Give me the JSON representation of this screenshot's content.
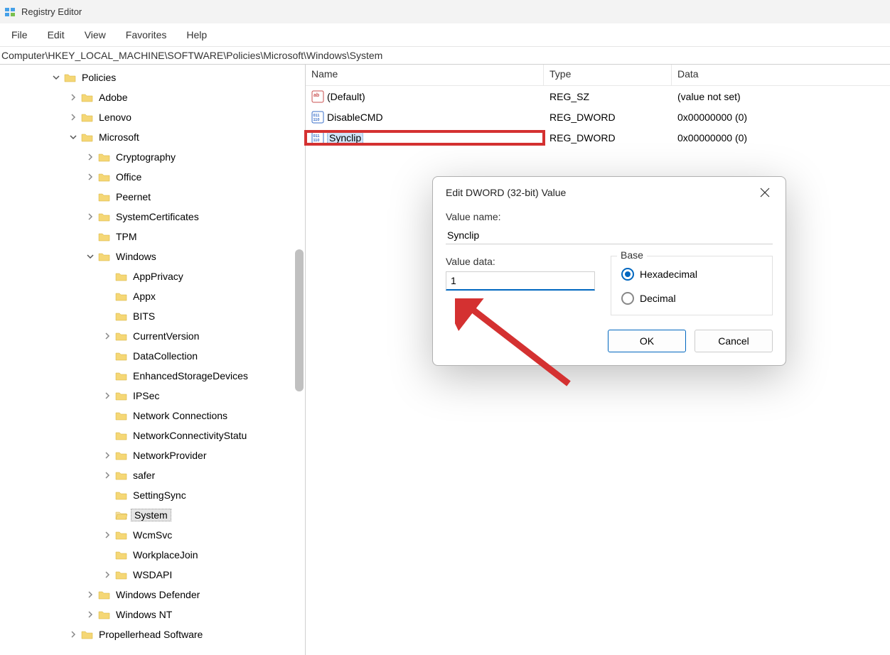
{
  "app": {
    "title": "Registry Editor"
  },
  "menu": {
    "items": [
      "File",
      "Edit",
      "View",
      "Favorites",
      "Help"
    ]
  },
  "address": "Computer\\HKEY_LOCAL_MACHINE\\SOFTWARE\\Policies\\Microsoft\\Windows\\System",
  "tree": [
    {
      "indent": 3,
      "label": "Policies",
      "expanded": true,
      "children": true
    },
    {
      "indent": 4,
      "label": "Adobe",
      "expanded": false,
      "children": true
    },
    {
      "indent": 4,
      "label": "Lenovo",
      "expanded": false,
      "children": true
    },
    {
      "indent": 4,
      "label": "Microsoft",
      "expanded": true,
      "children": true
    },
    {
      "indent": 5,
      "label": "Cryptography",
      "expanded": false,
      "children": true
    },
    {
      "indent": 5,
      "label": "Office",
      "expanded": false,
      "children": true
    },
    {
      "indent": 5,
      "label": "Peernet",
      "expanded": false,
      "children": false
    },
    {
      "indent": 5,
      "label": "SystemCertificates",
      "expanded": false,
      "children": true
    },
    {
      "indent": 5,
      "label": "TPM",
      "expanded": false,
      "children": false
    },
    {
      "indent": 5,
      "label": "Windows",
      "expanded": true,
      "children": true
    },
    {
      "indent": 6,
      "label": "AppPrivacy",
      "expanded": false,
      "children": false
    },
    {
      "indent": 6,
      "label": "Appx",
      "expanded": false,
      "children": false
    },
    {
      "indent": 6,
      "label": "BITS",
      "expanded": false,
      "children": false
    },
    {
      "indent": 6,
      "label": "CurrentVersion",
      "expanded": false,
      "children": true
    },
    {
      "indent": 6,
      "label": "DataCollection",
      "expanded": false,
      "children": false
    },
    {
      "indent": 6,
      "label": "EnhancedStorageDevices",
      "expanded": false,
      "children": false
    },
    {
      "indent": 6,
      "label": "IPSec",
      "expanded": false,
      "children": true
    },
    {
      "indent": 6,
      "label": "Network Connections",
      "expanded": false,
      "children": false
    },
    {
      "indent": 6,
      "label": "NetworkConnectivityStatu",
      "expanded": false,
      "children": false
    },
    {
      "indent": 6,
      "label": "NetworkProvider",
      "expanded": false,
      "children": true
    },
    {
      "indent": 6,
      "label": "safer",
      "expanded": false,
      "children": true
    },
    {
      "indent": 6,
      "label": "SettingSync",
      "expanded": false,
      "children": false
    },
    {
      "indent": 6,
      "label": "System",
      "expanded": false,
      "children": false,
      "selected": true
    },
    {
      "indent": 6,
      "label": "WcmSvc",
      "expanded": false,
      "children": true
    },
    {
      "indent": 6,
      "label": "WorkplaceJoin",
      "expanded": false,
      "children": false
    },
    {
      "indent": 6,
      "label": "WSDAPI",
      "expanded": false,
      "children": true
    },
    {
      "indent": 5,
      "label": "Windows Defender",
      "expanded": false,
      "children": true
    },
    {
      "indent": 5,
      "label": "Windows NT",
      "expanded": false,
      "children": true
    },
    {
      "indent": 4,
      "label": "Propellerhead Software",
      "expanded": false,
      "children": true
    }
  ],
  "values": {
    "headers": {
      "name": "Name",
      "type": "Type",
      "data": "Data"
    },
    "rows": [
      {
        "icon": "sz",
        "name": "(Default)",
        "type": "REG_SZ",
        "data": "(value not set)"
      },
      {
        "icon": "dword",
        "name": "DisableCMD",
        "type": "REG_DWORD",
        "data": "0x00000000 (0)"
      },
      {
        "icon": "dword",
        "name": "Synclip",
        "type": "REG_DWORD",
        "data": "0x00000000 (0)",
        "highlighted": true
      }
    ]
  },
  "dialog": {
    "title": "Edit DWORD (32-bit) Value",
    "valueNameLabel": "Value name:",
    "valueName": "Synclip",
    "valueDataLabel": "Value data:",
    "valueData": "1",
    "baseLabel": "Base",
    "hexLabel": "Hexadecimal",
    "decLabel": "Decimal",
    "ok": "OK",
    "cancel": "Cancel"
  }
}
